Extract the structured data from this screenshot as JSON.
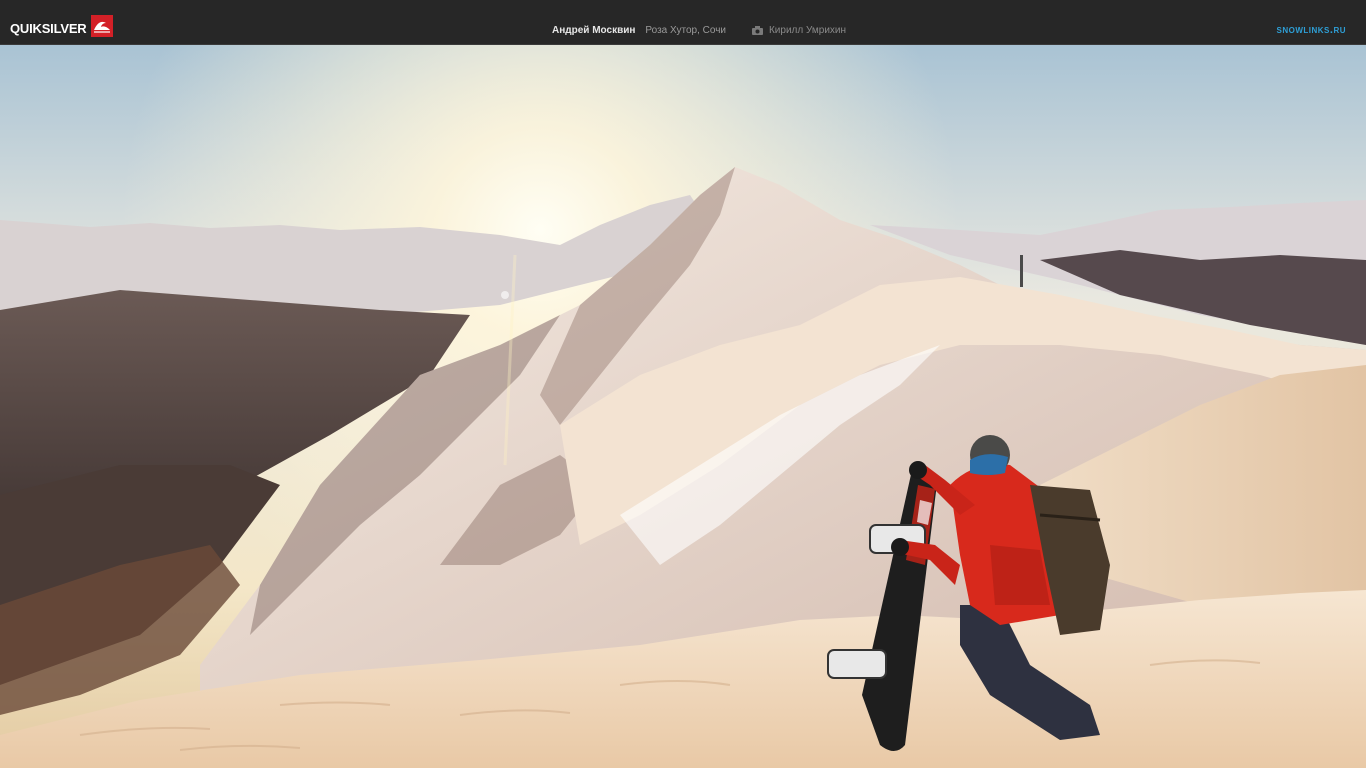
{
  "header": {
    "brand": "QUIKSILVER",
    "brand_logo_icon": "quiksilver-wave-logo-icon",
    "rider_name": "Андрей Москвин",
    "location": "Роза Хутор, Сочи",
    "camera_icon": "camera-icon",
    "photographer": "Кирилл Умрихин",
    "site_link": "snowlinks.ru"
  },
  "colors": {
    "topbar": "#272727",
    "brand_red": "#d32027",
    "link_blue": "#2e9fd6",
    "jacket_red": "#d8291c"
  },
  "photo": {
    "subject": "snowboarder-kneeling-on-mountain-ridge-at-sunset"
  }
}
